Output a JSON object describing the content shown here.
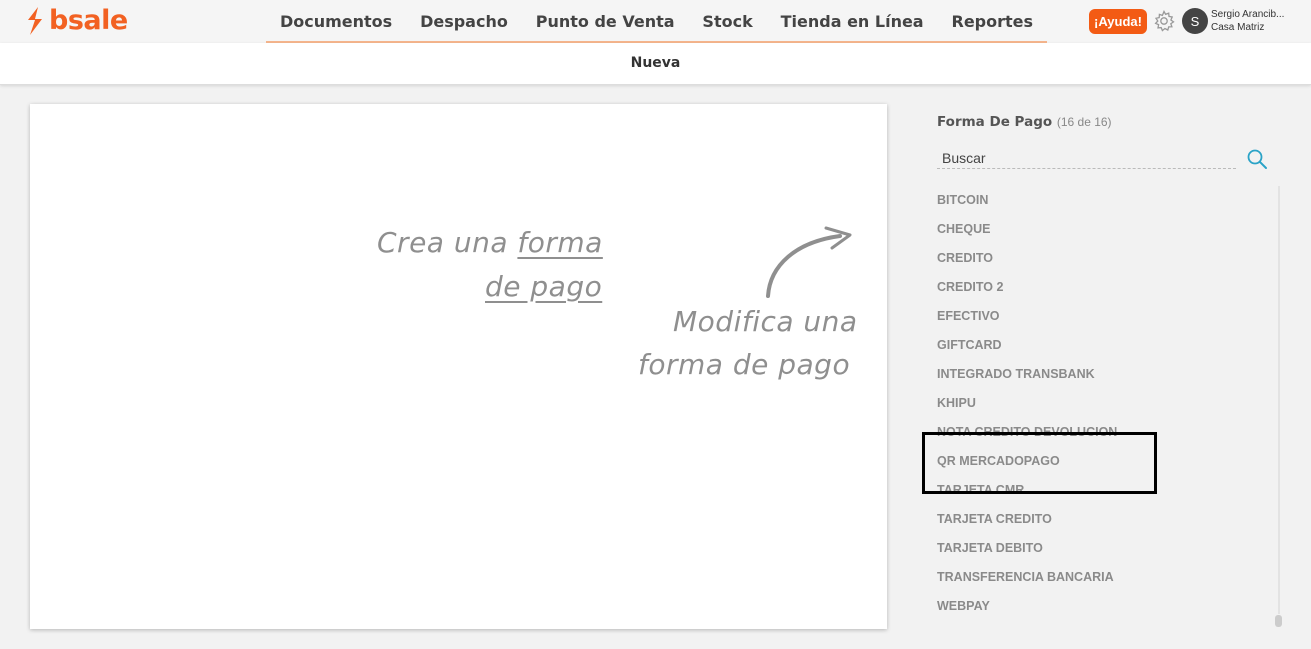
{
  "brand": {
    "name": "bsale",
    "color": "#f26122"
  },
  "nav": {
    "items": [
      "Documentos",
      "Despacho",
      "Punto de Venta",
      "Stock",
      "Tienda en Línea",
      "Reportes"
    ]
  },
  "header": {
    "help_label": "¡Ayuda!",
    "avatar_initial": "S",
    "user_name": "Sergio Arancib...",
    "branch": "Casa Matriz"
  },
  "subnav": {
    "new_label": "Nueva"
  },
  "main": {
    "hint_create_prefix": "Crea una",
    "hint_create_link_1": "forma",
    "hint_create_link_2": "de pago",
    "hint_modify_1": "Modifica una",
    "hint_modify_2": "forma de pago"
  },
  "panel": {
    "title": "Forma De Pago",
    "count": "(16 de 16)",
    "search_placeholder": "Buscar",
    "items": [
      "BITCOIN",
      "CHEQUE",
      "CREDITO",
      "CREDITO 2",
      "EFECTIVO",
      "GIFTCARD",
      "INTEGRADO TRANSBANK",
      "KHIPU",
      "NOTA CREDITO DEVOLUCION",
      "QR MERCADOPAGO",
      "TARJETA CMR",
      "TARJETA CREDITO",
      "TARJETA DEBITO",
      "TRANSFERENCIA BANCARIA",
      "WEBPAY"
    ]
  },
  "colors": {
    "accent": "#f35b14",
    "nav_underline": "#f6b68e",
    "list_text": "#8a8a8a",
    "handwriting": "#8f8f8f",
    "search_icon": "#2aa3c7"
  }
}
